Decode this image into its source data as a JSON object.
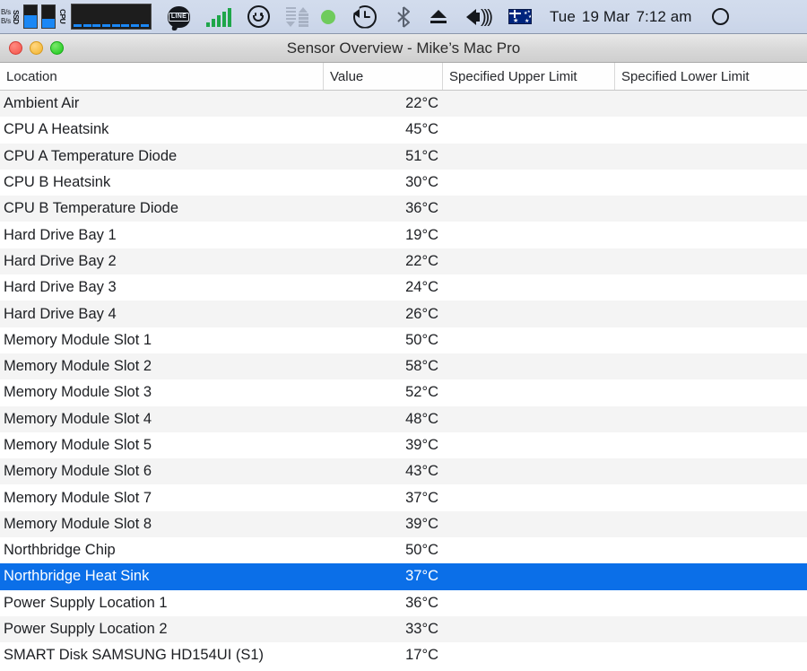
{
  "menubar": {
    "network_speeds": {
      "upload": "B/s",
      "download": "B/s"
    },
    "ssd_label": "SSD",
    "cpu_label": "CPU",
    "line_label": "LINE",
    "clock": {
      "day": "Tue",
      "date": "19 Mar",
      "time": "7:12 am"
    },
    "icons": [
      "network-speed-icon",
      "ssd-gauge-icon",
      "cpu-graph-icon",
      "line-app-icon",
      "signal-bars-icon",
      "smiley-icon",
      "network-traffic-icon",
      "status-dot-icon",
      "time-machine-icon",
      "bluetooth-icon",
      "eject-icon",
      "volume-icon",
      "australia-flag-icon",
      "spotlight-search-icon"
    ]
  },
  "window": {
    "title": "Sensor Overview - Mike’s Mac Pro",
    "traffic_lights": [
      "close-button",
      "minimize-button",
      "zoom-button"
    ]
  },
  "table": {
    "columns": [
      "Location",
      "Value",
      "Specified Upper Limit",
      "Specified Lower Limit"
    ],
    "selected_index": 18,
    "rows": [
      {
        "location": "Ambient Air",
        "value": "22°C",
        "upper": "",
        "lower": ""
      },
      {
        "location": "CPU A Heatsink",
        "value": "45°C",
        "upper": "",
        "lower": ""
      },
      {
        "location": "CPU A Temperature Diode",
        "value": "51°C",
        "upper": "",
        "lower": ""
      },
      {
        "location": "CPU B Heatsink",
        "value": "30°C",
        "upper": "",
        "lower": ""
      },
      {
        "location": "CPU B Temperature Diode",
        "value": "36°C",
        "upper": "",
        "lower": ""
      },
      {
        "location": "Hard Drive Bay 1",
        "value": "19°C",
        "upper": "",
        "lower": ""
      },
      {
        "location": "Hard Drive Bay 2",
        "value": "22°C",
        "upper": "",
        "lower": ""
      },
      {
        "location": "Hard Drive Bay 3",
        "value": "24°C",
        "upper": "",
        "lower": ""
      },
      {
        "location": "Hard Drive Bay 4",
        "value": "26°C",
        "upper": "",
        "lower": ""
      },
      {
        "location": "Memory Module Slot 1",
        "value": "50°C",
        "upper": "",
        "lower": ""
      },
      {
        "location": "Memory Module Slot 2",
        "value": "58°C",
        "upper": "",
        "lower": ""
      },
      {
        "location": "Memory Module Slot 3",
        "value": "52°C",
        "upper": "",
        "lower": ""
      },
      {
        "location": "Memory Module Slot 4",
        "value": "48°C",
        "upper": "",
        "lower": ""
      },
      {
        "location": "Memory Module Slot 5",
        "value": "39°C",
        "upper": "",
        "lower": ""
      },
      {
        "location": "Memory Module Slot 6",
        "value": "43°C",
        "upper": "",
        "lower": ""
      },
      {
        "location": "Memory Module Slot 7",
        "value": "37°C",
        "upper": "",
        "lower": ""
      },
      {
        "location": "Memory Module Slot 8",
        "value": "39°C",
        "upper": "",
        "lower": ""
      },
      {
        "location": "Northbridge Chip",
        "value": "50°C",
        "upper": "",
        "lower": ""
      },
      {
        "location": "Northbridge Heat Sink",
        "value": "37°C",
        "upper": "",
        "lower": ""
      },
      {
        "location": "Power Supply Location 1",
        "value": "36°C",
        "upper": "",
        "lower": ""
      },
      {
        "location": "Power Supply Location 2",
        "value": "33°C",
        "upper": "",
        "lower": ""
      },
      {
        "location": "SMART Disk SAMSUNG HD154UI (S1)",
        "value": "17°C",
        "upper": "",
        "lower": ""
      }
    ]
  },
  "colors": {
    "selection_blue": "#0b6fe8",
    "stripe_gray": "#f4f4f4",
    "menubar_blue": "#cfd9eb"
  }
}
